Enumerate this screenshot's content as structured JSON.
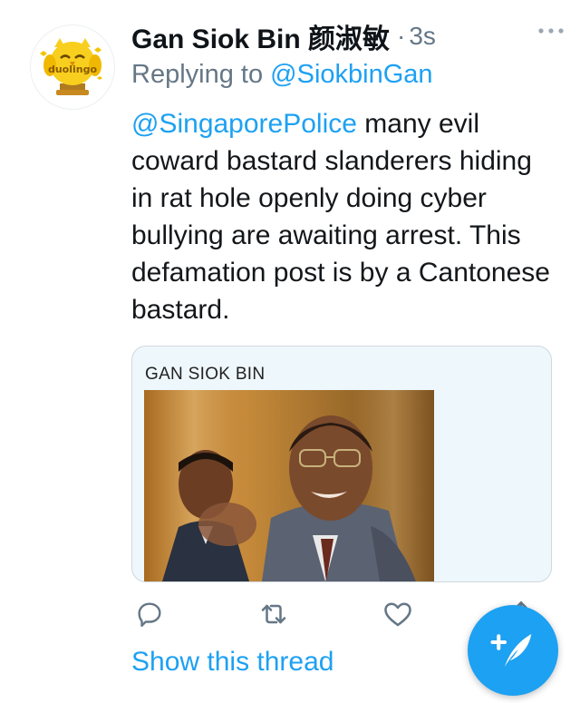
{
  "tweet": {
    "display_name": "Gan Siok Bin 颜淑敏",
    "separator": "·",
    "timestamp": "3s",
    "reply_prefix": "Replying to ",
    "reply_handle": "@SiokbinGan",
    "mention": "@SingaporePolice",
    "body": " many evil coward bastard slanderers hiding in rat hole openly doing cyber bullying are awaiting arrest.  This defamation post is by a Cantonese bastard.",
    "media_caption": "GAN SIOK BIN",
    "show_thread": "Show this thread"
  },
  "avatar": {
    "logo_text": "duolingo",
    "brand_color": "#f4c400"
  },
  "icons": {
    "more": "more-dots-icon",
    "reply": "reply-icon",
    "retweet": "retweet-icon",
    "like": "heart-icon",
    "share": "share-icon",
    "compose": "compose-tweet-icon"
  },
  "colors": {
    "accent": "#1da1f2",
    "secondary_text": "#657786",
    "primary_text": "#14171a"
  }
}
